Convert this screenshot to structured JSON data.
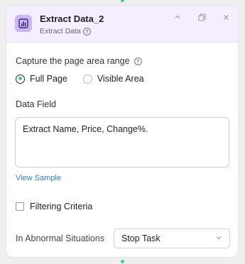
{
  "node": {
    "title": "Extract Data_2",
    "subtitle": "Extract Data",
    "icon": "bar-chart-icon",
    "accent_color": "#c9b8f5",
    "header_bg": "#f4eefe"
  },
  "header_actions": {
    "collapse_icon": "chevron-up-icon",
    "copy_icon": "copy-icon",
    "close_icon": "close-icon"
  },
  "capture": {
    "label": "Capture the page area range",
    "help_icon": "help-icon",
    "options": [
      {
        "label": "Full Page",
        "selected": true
      },
      {
        "label": "Visible Area",
        "selected": false
      }
    ],
    "selected_color": "#3ecf8e"
  },
  "data_field": {
    "label": "Data Field",
    "value": "Extract Name, Price, Change%."
  },
  "view_sample": {
    "label": "View Sample",
    "color": "#2f7bd6"
  },
  "filtering": {
    "label": "Filtering Criteria",
    "checked": false
  },
  "abnormal": {
    "label": "In Abnormal Situations",
    "selected": "Stop Task"
  }
}
